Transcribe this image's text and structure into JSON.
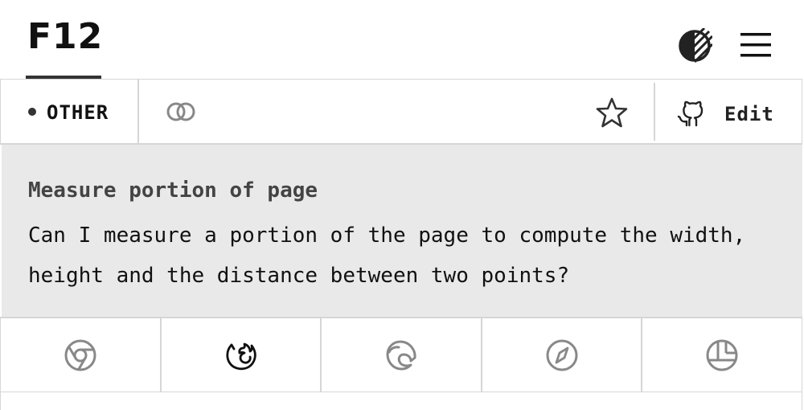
{
  "header": {
    "logo_text": "F12",
    "theme_toggle_icon": "contrast-icon",
    "menu_icon": "hamburger-menu-icon"
  },
  "toolbar": {
    "category_label": "OTHER",
    "link_icon": "link-icon",
    "star_icon": "star-icon",
    "edit_icon": "github-icon",
    "edit_label": "Edit"
  },
  "description": {
    "title": "Measure portion of page",
    "body": "Can I measure a portion of the page to compute the width, height and the distance between two points?"
  },
  "browsers": [
    {
      "name": "Chrome",
      "icon": "chrome-icon",
      "active": false
    },
    {
      "name": "Firefox",
      "icon": "firefox-icon",
      "active": true
    },
    {
      "name": "Edge",
      "icon": "edge-icon",
      "active": false
    },
    {
      "name": "Safari",
      "icon": "safari-icon",
      "active": false
    },
    {
      "name": "Polypane",
      "icon": "polypane-icon",
      "active": false
    }
  ],
  "colors": {
    "text": "#111111",
    "muted_icon": "#888888",
    "panel_background": "#e9e9e9",
    "border": "#d6d6d6"
  }
}
